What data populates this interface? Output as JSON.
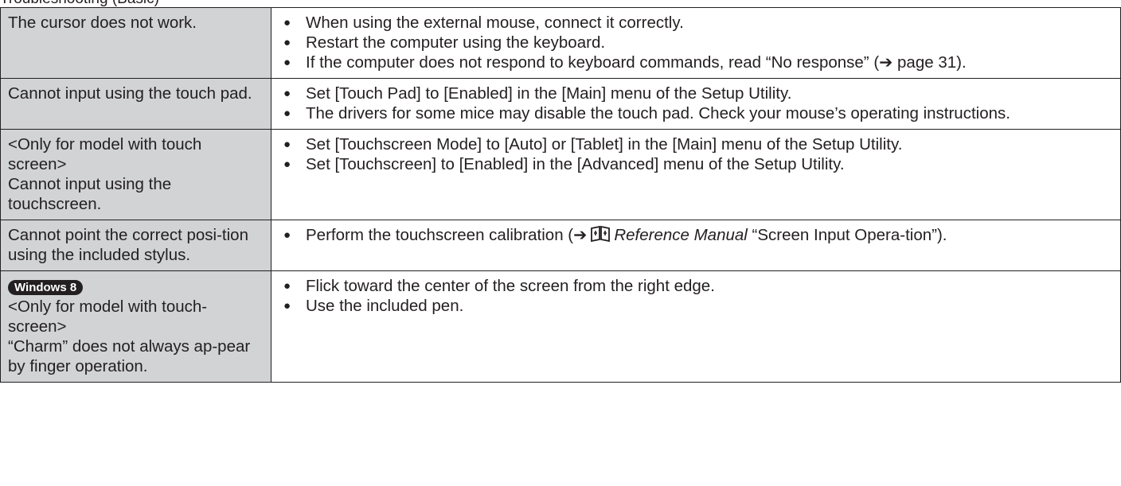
{
  "rows": [
    {
      "problem": [
        "The cursor does not work."
      ],
      "solutions": [
        {
          "text": "When using the external mouse, connect it correctly."
        },
        {
          "text": "Restart the computer using the keyboard."
        },
        {
          "text": "If the computer does not respond to keyboard commands, read “No response” (➔ page 31)."
        }
      ]
    },
    {
      "problem": [
        "Cannot input using the touch pad."
      ],
      "solutions": [
        {
          "text": "Set [Touch Pad] to [Enabled] in the [Main] menu of the Setup Utility."
        },
        {
          "text": "The drivers for some mice may disable the touch pad. Check your mouse’s operating instructions."
        }
      ]
    },
    {
      "problem": [
        "<Only for model with touch screen>",
        "Cannot input using the touchscreen."
      ],
      "solutions": [
        {
          "text": "Set [Touchscreen Mode] to [Auto] or [Tablet] in the [Main] menu of the Setup Utility."
        },
        {
          "text": "Set [Touchscreen] to [Enabled] in the [Advanced] menu of the Setup Utility."
        }
      ]
    },
    {
      "problem": [
        "Cannot point the correct posi-tion using the included stylus."
      ],
      "solutions": [
        {
          "prefix": "Perform the touchscreen calibration (➔",
          "icon": "reference-manual-icon",
          "ref": "Reference Manual",
          "suffix": "“Screen Input Opera-tion”)."
        }
      ]
    },
    {
      "badge": "Windows 8",
      "problem": [
        "<Only for model with touch-screen>",
        "“Charm” does not always ap-pear by finger operation."
      ],
      "solutions": [
        {
          "text": "Flick toward the center of the screen from the right edge."
        },
        {
          "text": "Use the included pen."
        }
      ]
    }
  ],
  "bullet_glyph": "●",
  "top_text": "Troubleshooting (Basic)"
}
